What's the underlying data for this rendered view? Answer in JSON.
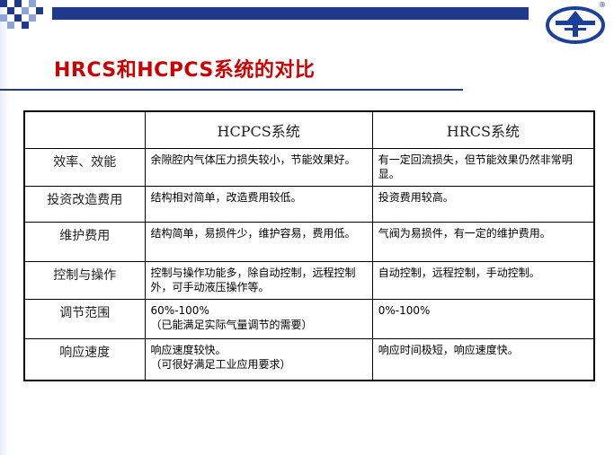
{
  "slide": {
    "title": "HRCS和HCPCS系统的对比",
    "colors": {
      "title": "#cc0000",
      "header_bar": "#1f3a8a",
      "checker_blue": "#1f3a8a",
      "checker_light": "#8da3d6",
      "logo_blue": "#1a3f9c"
    },
    "logo": {
      "icon": "company-emblem-icon",
      "mark": "®"
    }
  },
  "table": {
    "headers": [
      "",
      "HCPCS系统",
      "HRCS系统"
    ],
    "rows": [
      {
        "feature": "效率、效能",
        "hcpcs": "余隙腔内气体压力损失较小，节能效果好。",
        "hrcs": "有一定回流损失，但节能效果仍然非常明显。"
      },
      {
        "feature": "投资改造费用",
        "hcpcs": "结构相对简单，改造费用较低。",
        "hrcs": "投资费用较高。"
      },
      {
        "feature": "维护费用",
        "hcpcs": "结构简单，易损件少，维护容易，费用低。",
        "hrcs": "气阀为易损件，有一定的维护费用。"
      },
      {
        "feature": "控制与操作",
        "hcpcs": "控制与操作功能多，除自动控制，远程控制外，可手动液压操作等。",
        "hrcs": "自动控制，远程控制，手动控制。"
      },
      {
        "feature": "调节范围",
        "hcpcs_line1": "60%-100%",
        "hcpcs_line2": "（已能满足实际气量调节的需要）",
        "hrcs": "0%-100%"
      },
      {
        "feature": "响应速度",
        "hcpcs_line1": "响应速度较快。",
        "hcpcs_line2": "（可很好满足工业应用要求）",
        "hrcs": "响应时间极短，响应速度快。"
      }
    ]
  }
}
